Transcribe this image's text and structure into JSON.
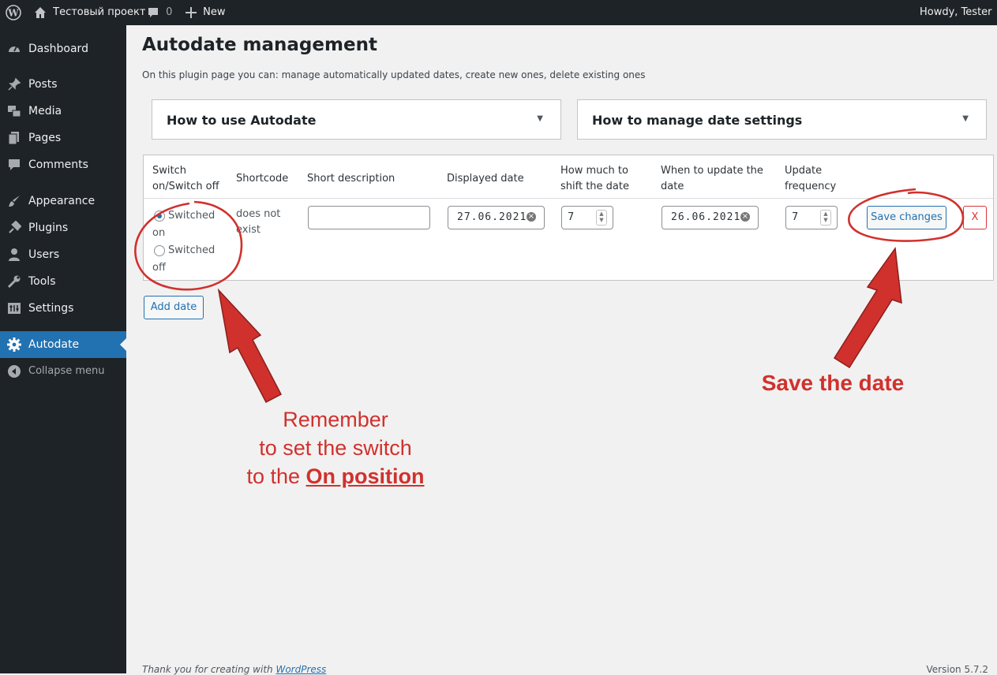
{
  "admin_bar": {
    "site_name": "Тестовый проект",
    "comments_count": "0",
    "new_label": "New",
    "greeting": "Howdy, Tester"
  },
  "sidebar": {
    "items": [
      {
        "label": "Dashboard",
        "icon": "dashboard-icon"
      },
      {
        "label": "Posts",
        "icon": "pin-icon"
      },
      {
        "label": "Media",
        "icon": "media-icon"
      },
      {
        "label": "Pages",
        "icon": "pages-icon"
      },
      {
        "label": "Comments",
        "icon": "comment-icon"
      },
      {
        "label": "Appearance",
        "icon": "brush-icon"
      },
      {
        "label": "Plugins",
        "icon": "plug-icon"
      },
      {
        "label": "Users",
        "icon": "user-icon"
      },
      {
        "label": "Tools",
        "icon": "wrench-icon"
      },
      {
        "label": "Settings",
        "icon": "settings-icon"
      },
      {
        "label": "Autodate",
        "icon": "gear-icon",
        "current": true
      },
      {
        "label": "Collapse menu",
        "icon": "collapse-icon"
      }
    ]
  },
  "page": {
    "title": "Autodate management",
    "intro": "On this plugin page you can: manage automatically updated dates, create new ones, delete existing ones"
  },
  "accordions": [
    {
      "title": "How to use Autodate"
    },
    {
      "title": "How to manage date settings"
    }
  ],
  "table": {
    "headers": {
      "switch": [
        "Switch",
        "on/Switch off"
      ],
      "shortcode": "Shortcode",
      "short_description": "Short description",
      "displayed_date": "Displayed date",
      "shift": [
        "How much to",
        "shift the date"
      ],
      "when_update": [
        "When to update the",
        "date"
      ],
      "frequency": [
        "Update",
        "frequency"
      ]
    },
    "row": {
      "switch_on_label": [
        "Switched",
        "on"
      ],
      "switch_off_label": [
        "Switched",
        "off"
      ],
      "switch_state": "on",
      "shortcode": [
        "does not",
        "exist"
      ],
      "short_description_value": "",
      "displayed_date": "27.06.2021",
      "shift_value": "7",
      "when_update_date": "26.06.2021",
      "frequency_value": "7",
      "save_label": "Save changes",
      "delete_label": "X"
    }
  },
  "add_date_label": "Add date",
  "footer": {
    "thanks_prefix": "Thank you for creating with",
    "thanks_link": "WordPress",
    "version": "Version 5.7.2"
  },
  "annotations": {
    "switch_note": {
      "line1": "Remember",
      "line2": "to set the switch",
      "line3_prefix": "to the",
      "line3_emphasis": "On position"
    },
    "save_note": "Save the date",
    "color": "#d0312d"
  },
  "colors": {
    "admin_dark": "#1d2327",
    "accent": "#2271b1",
    "danger": "#d63638",
    "background": "#f1f1f1"
  }
}
